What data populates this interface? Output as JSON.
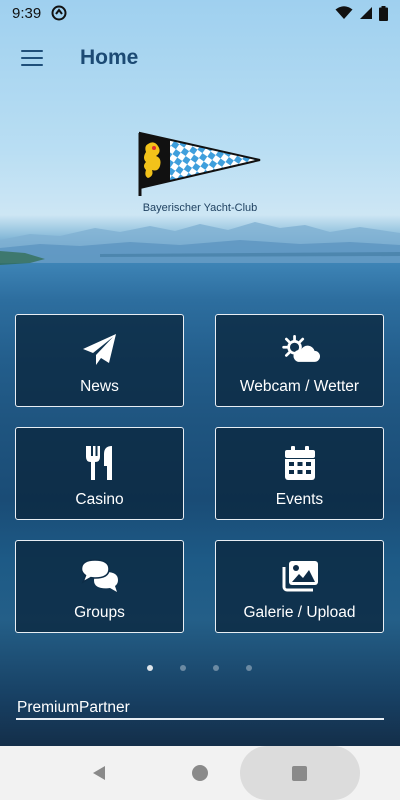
{
  "status_bar": {
    "time": "9:39",
    "icons": [
      "app-notification-icon",
      "wifi-icon",
      "cellular-signal-icon",
      "battery-icon"
    ]
  },
  "app_bar": {
    "menu_icon": "hamburger-menu-icon",
    "title": "Home"
  },
  "logo": {
    "caption": "Bayerischer Yacht-Club",
    "colors": {
      "blue": "#3f9fdc",
      "yellow": "#f2c21a",
      "black": "#111111"
    }
  },
  "tiles": [
    {
      "label": "News",
      "icon": "paper-plane-icon"
    },
    {
      "label": "Webcam / Wetter",
      "icon": "sun-cloud-icon"
    },
    {
      "label": "Casino",
      "icon": "fork-knife-icon"
    },
    {
      "label": "Events",
      "icon": "calendar-icon"
    },
    {
      "label": "Groups",
      "icon": "chat-bubbles-icon"
    },
    {
      "label": "Galerie / Upload",
      "icon": "images-icon"
    }
  ],
  "pager": {
    "count": 4,
    "active": 0
  },
  "partner": {
    "label": "PremiumPartner"
  },
  "nav_bar": {
    "icons": [
      "back-icon",
      "home-icon",
      "recents-icon"
    ]
  },
  "colors": {
    "tile_background": "#0a263e",
    "tile_border": "#e8eef4",
    "title": "#1c4a74"
  }
}
